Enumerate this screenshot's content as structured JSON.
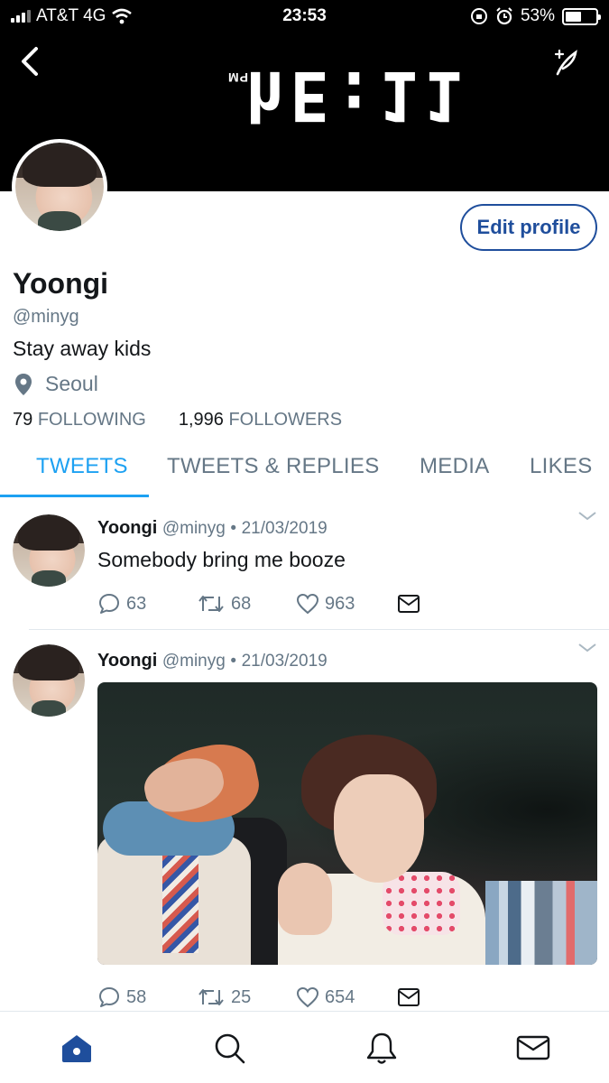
{
  "status_bar": {
    "carrier": "AT&T 4G",
    "time": "23:53",
    "battery_percent": "53%",
    "battery_level": 0.53
  },
  "header": {
    "clock_image_text": "hE:11",
    "clock_image_suffix": "PM"
  },
  "profile": {
    "name": "Yoongi",
    "handle": "@minyg",
    "bio": "Stay away kids",
    "location": "Seoul",
    "following_count": "79",
    "following_label": "FOLLOWING",
    "followers_count": "1,996",
    "followers_label": "FOLLOWERS",
    "edit_profile_label": "Edit profile"
  },
  "tabs": [
    {
      "label": "TWEETS",
      "active": true
    },
    {
      "label": "TWEETS & REPLIES",
      "active": false
    },
    {
      "label": "MEDIA",
      "active": false
    },
    {
      "label": "LIKES",
      "active": false
    }
  ],
  "tweets": [
    {
      "name": "Yoongi",
      "handle": "@minyg",
      "date": "21/03/2019",
      "text": "Somebody bring me booze",
      "replies": "63",
      "retweets": "68",
      "likes": "963"
    },
    {
      "name": "Yoongi",
      "handle": "@minyg",
      "date": "21/03/2019",
      "text": "",
      "replies": "58",
      "retweets": "25",
      "likes": "654"
    }
  ],
  "colors": {
    "accent": "#1da1f2",
    "edit_button": "#1f4e9c",
    "secondary_text": "#657786",
    "nav_active": "#1f4e9c"
  },
  "icons": {
    "back": "chevron-left-icon",
    "compose": "quill-icon",
    "location": "map-pin-icon",
    "reply": "speech-bubble-icon",
    "retweet": "retweet-icon",
    "like": "heart-icon",
    "dm": "envelope-icon",
    "home": "home-icon",
    "search": "search-icon",
    "notifications": "bell-icon",
    "messages": "envelope-icon"
  }
}
